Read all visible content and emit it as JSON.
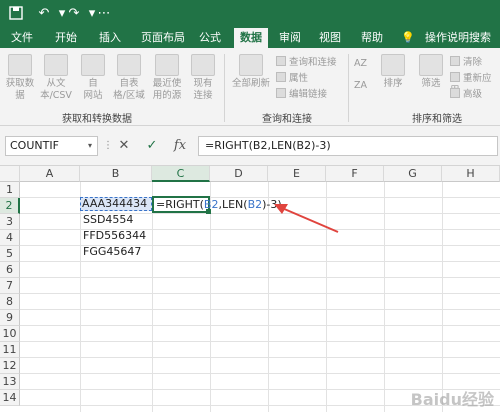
{
  "quick_access": {
    "save_icon": "save-icon",
    "undo_icon": "undo-icon",
    "redo_icon": "redo-icon",
    "customize_icon": "customize-icon"
  },
  "tabs": [
    {
      "label": "文件"
    },
    {
      "label": "开始"
    },
    {
      "label": "插入"
    },
    {
      "label": "页面布局"
    },
    {
      "label": "公式"
    },
    {
      "label": "数据"
    },
    {
      "label": "审阅"
    },
    {
      "label": "视图"
    },
    {
      "label": "帮助"
    },
    {
      "label": "操作说明搜索"
    }
  ],
  "ribbon": {
    "get_data": {
      "line1": "获取数",
      "line2": "据"
    },
    "from_csv": {
      "line1": "从文",
      "line2": "本/CSV"
    },
    "from_web": {
      "line1": "自",
      "line2": "网站"
    },
    "from_table": {
      "line1": "自表",
      "line2": "格/区域"
    },
    "recent": {
      "line1": "最近使",
      "line2": "用的源"
    },
    "existing": {
      "line1": "现有",
      "line2": "连接"
    },
    "group1_label": "获取和转换数据",
    "refresh_all": {
      "line1": "全部刷新",
      "line2": ""
    },
    "queries": "查询和连接",
    "properties": "属性",
    "edit_links": "编辑链接",
    "group2_label": "查询和连接",
    "sort_az": "AZ",
    "sort_za": "ZA",
    "sort": "排序",
    "filter": "筛选",
    "clear": "清除",
    "reapply": "重新应用",
    "advanced": "高级",
    "group3_label": "排序和筛选"
  },
  "formula_bar": {
    "name_box": "COUNTIF",
    "cancel": "✕",
    "enter": "✓",
    "fx": "fx",
    "formula": "=RIGHT(B2,LEN(B2)-3)"
  },
  "columns": [
    "A",
    "B",
    "C",
    "D",
    "E",
    "F",
    "G",
    "H"
  ],
  "rows": [
    "1",
    "2",
    "3",
    "4",
    "5",
    "6",
    "7",
    "8",
    "9",
    "10",
    "11",
    "12",
    "13",
    "14"
  ],
  "cells": {
    "B2": "AAA344434",
    "B3": "SSD4554",
    "B4": "FFD556344",
    "B5": "FGG45647",
    "C2_parts": [
      "=RIGHT(",
      "B2",
      ",LEN(",
      "B2",
      ")-3)"
    ]
  },
  "watermark": "Baidu经验",
  "colors": {
    "excel_green": "#217346",
    "ref_blue": "#3a74c9",
    "arrow_red": "#e0443e"
  }
}
